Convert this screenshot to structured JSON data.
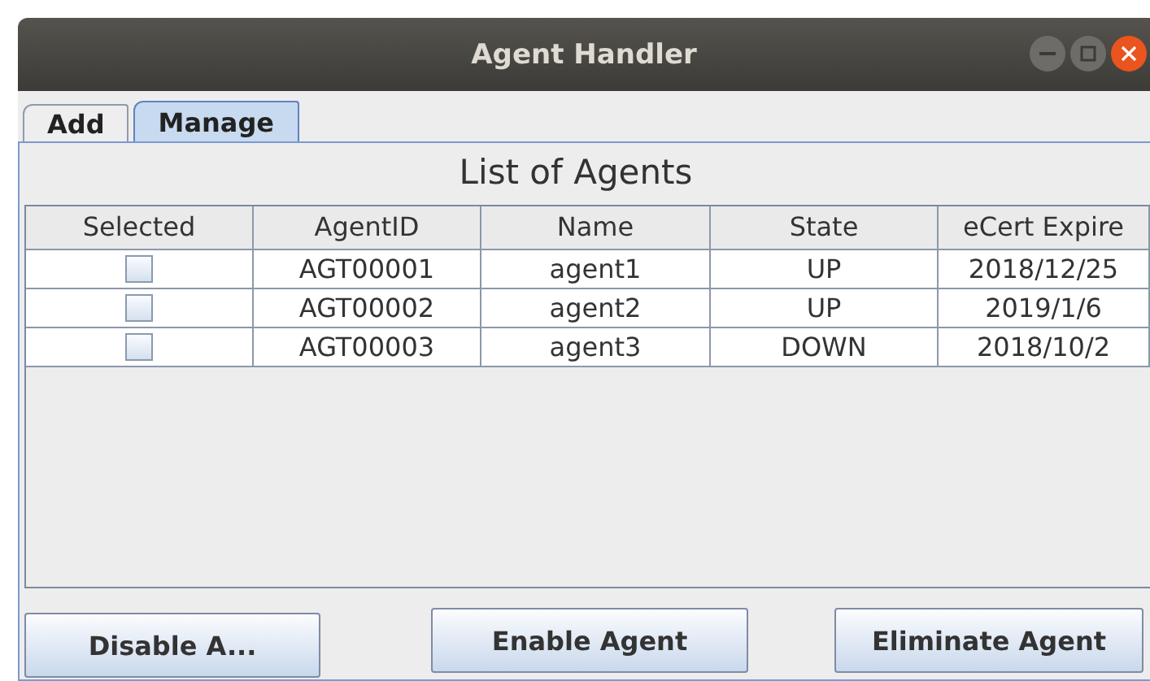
{
  "window": {
    "title": "Agent Handler"
  },
  "tabs": [
    {
      "label": "Add",
      "selected": false
    },
    {
      "label": "Manage",
      "selected": true
    }
  ],
  "panel_title": "List of Agents",
  "table": {
    "columns": [
      "Selected",
      "AgentID",
      "Name",
      "State",
      "eCert Expire"
    ],
    "rows": [
      {
        "checked": false,
        "cells": [
          "",
          "AGT00001",
          "agent1",
          "UP",
          "2018/12/25"
        ]
      },
      {
        "checked": false,
        "cells": [
          "",
          "AGT00002",
          "agent2",
          "UP",
          "2019/1/6"
        ]
      },
      {
        "checked": false,
        "cells": [
          "",
          "AGT00003",
          "agent3",
          "DOWN",
          "2018/10/2"
        ]
      }
    ]
  },
  "buttons": [
    "Disable A...",
    "Enable Agent",
    "Eliminate Agent"
  ]
}
